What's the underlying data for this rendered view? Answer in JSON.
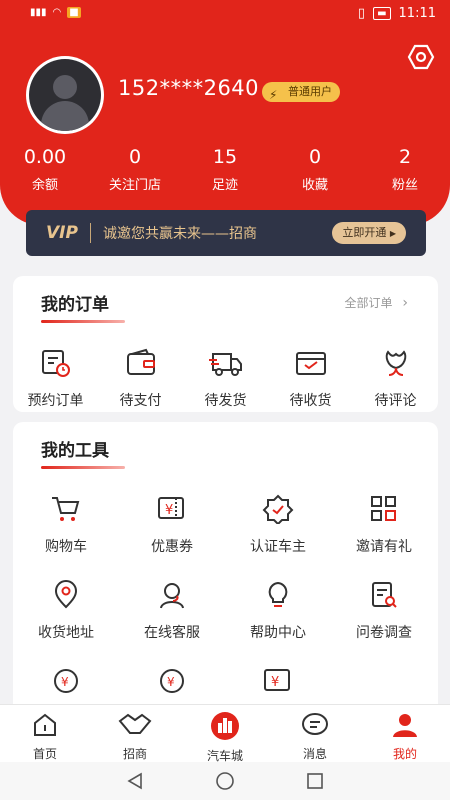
{
  "status": {
    "time": "11:11",
    "battery": "81"
  },
  "profile": {
    "phone": "152****2640",
    "badge": "普通用户"
  },
  "stats": [
    {
      "value": "0.00",
      "label": "余额"
    },
    {
      "value": "0",
      "label": "关注门店"
    },
    {
      "value": "15",
      "label": "足迹"
    },
    {
      "value": "0",
      "label": "收藏"
    },
    {
      "value": "2",
      "label": "粉丝"
    }
  ],
  "vip": {
    "logo": "VIP",
    "text": "诚邀您共赢未来——招商",
    "button": "立即开通"
  },
  "orders": {
    "title": "我的订单",
    "more": "全部订单",
    "items": [
      {
        "label": "预约订单",
        "icon": "reservation-order-icon"
      },
      {
        "label": "待支付",
        "icon": "wallet-icon"
      },
      {
        "label": "待发货",
        "icon": "truck-icon"
      },
      {
        "label": "待收货",
        "icon": "inbox-icon"
      },
      {
        "label": "待评论",
        "icon": "flower-icon"
      }
    ]
  },
  "tools": {
    "title": "我的工具",
    "items": [
      {
        "label": "购物车",
        "icon": "cart-icon"
      },
      {
        "label": "优惠券",
        "icon": "coupon-icon"
      },
      {
        "label": "认证车主",
        "icon": "certified-badge-icon"
      },
      {
        "label": "邀请有礼",
        "icon": "qr-grid-icon"
      },
      {
        "label": "收货地址",
        "icon": "location-icon"
      },
      {
        "label": "在线客服",
        "icon": "customer-service-icon"
      },
      {
        "label": "帮助中心",
        "icon": "help-bulb-icon"
      },
      {
        "label": "问卷调查",
        "icon": "survey-icon"
      }
    ]
  },
  "tabs": [
    {
      "label": "首页",
      "icon": "home-icon"
    },
    {
      "label": "招商",
      "icon": "handshake-icon"
    },
    {
      "label": "汽车城",
      "icon": "city-icon"
    },
    {
      "label": "消息",
      "icon": "message-icon"
    },
    {
      "label": "我的",
      "icon": "user-icon"
    }
  ],
  "colors": {
    "brand": "#e1251b",
    "vip_bg": "#2f3447",
    "vip_gold": "#e8c48e",
    "badge": "#f5c14b"
  }
}
